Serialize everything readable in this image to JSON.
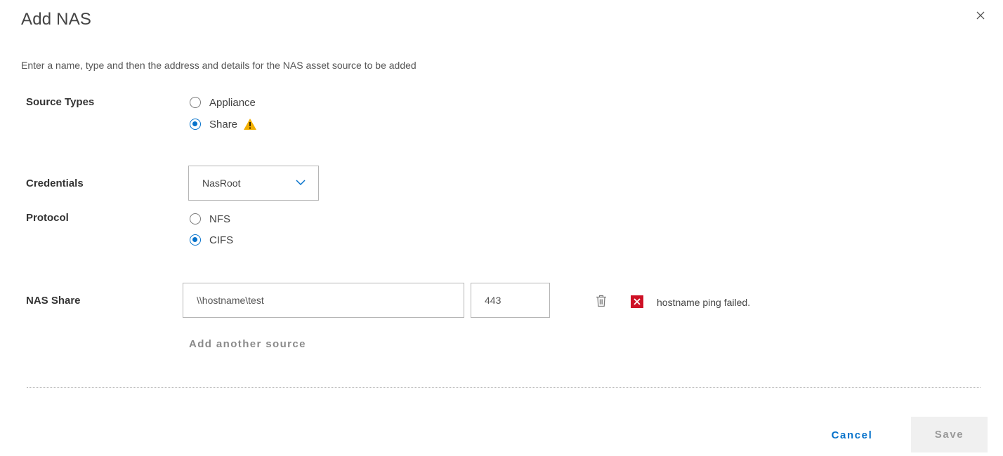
{
  "dialog": {
    "title": "Add NAS",
    "close_icon": "close-icon",
    "description": "Enter a name, type and then the address and details for the NAS asset source to be added"
  },
  "source_types": {
    "label": "Source Types",
    "options": [
      {
        "label": "Appliance",
        "selected": false
      },
      {
        "label": "Share",
        "selected": true,
        "icon": "warning-icon"
      }
    ],
    "warning_color": "#f2af00"
  },
  "credentials": {
    "label": "Credentials",
    "selected": "NasRoot"
  },
  "protocol": {
    "label": "Protocol",
    "options": [
      {
        "label": "NFS",
        "selected": false
      },
      {
        "label": "CIFS",
        "selected": true
      }
    ]
  },
  "nas_share": {
    "label": "NAS Share",
    "host_value": "\\\\hostname\\test",
    "port_value": "443",
    "delete_icon": "trash-icon",
    "error_icon": "error-x-icon",
    "error_message": "hostname ping failed.",
    "add_another": "Add another source"
  },
  "footer": {
    "cancel_label": "Cancel",
    "save_label": "Save"
  },
  "colors": {
    "accent": "#0672cb",
    "error": "#ce1126",
    "disabled_bg": "#f0f0f0"
  }
}
